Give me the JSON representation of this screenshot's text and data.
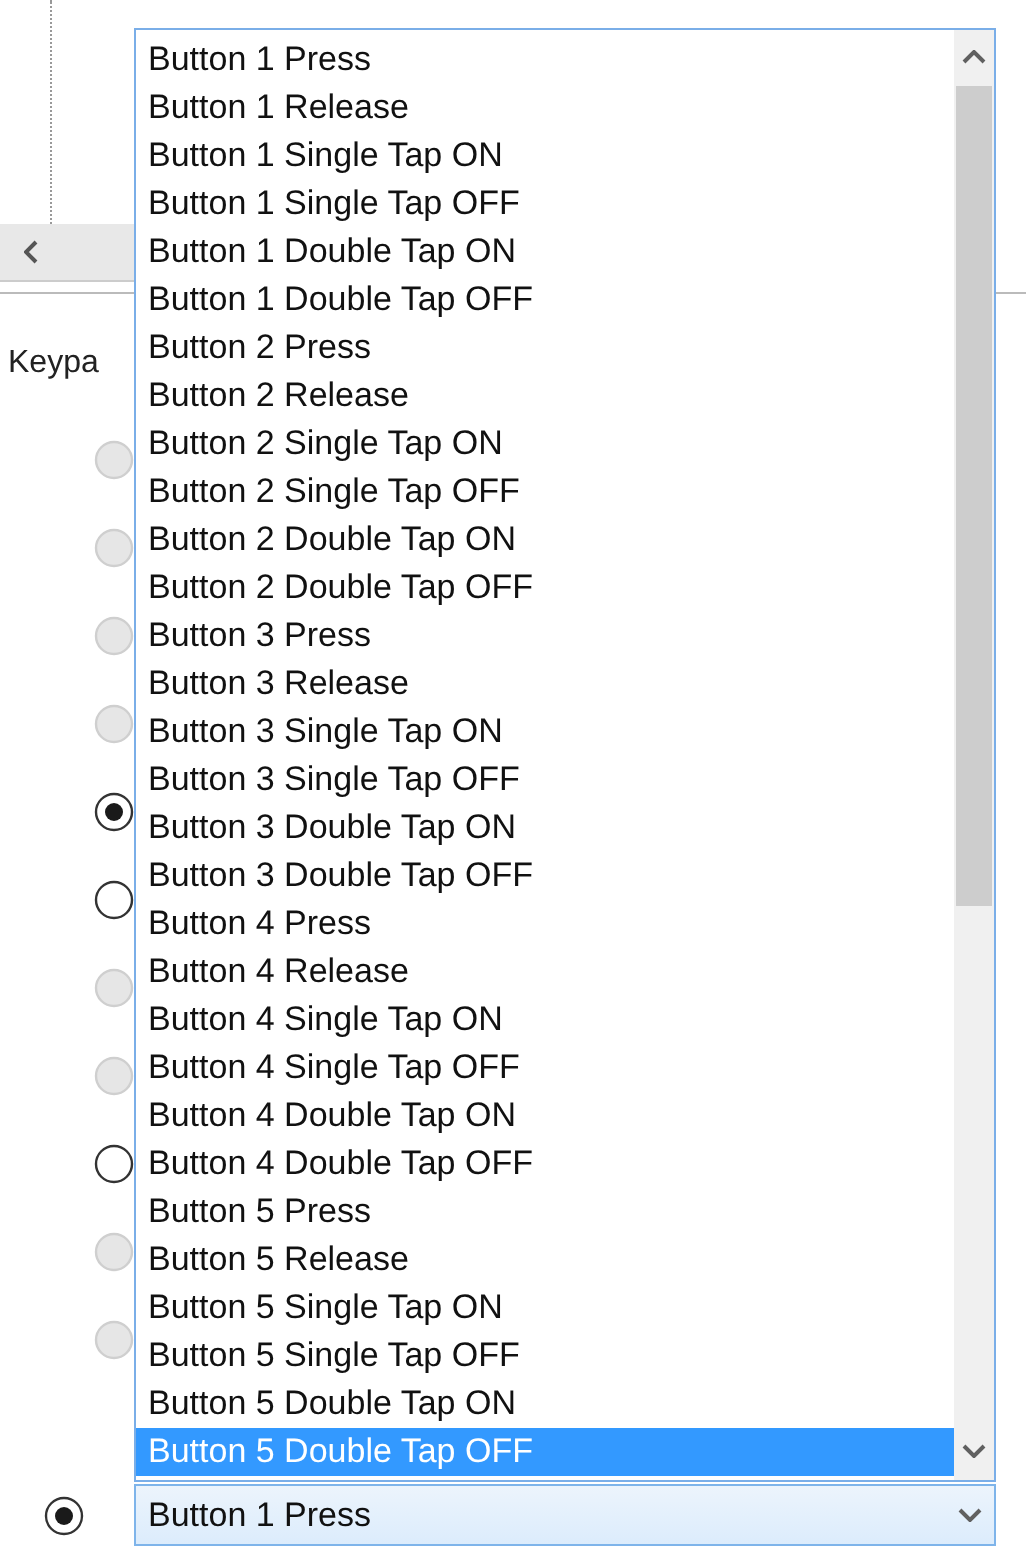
{
  "form": {
    "label": "Keypa"
  },
  "radios": [
    {
      "selected": false,
      "disabled": true
    },
    {
      "selected": false,
      "disabled": true
    },
    {
      "selected": false,
      "disabled": true
    },
    {
      "selected": false,
      "disabled": true
    },
    {
      "selected": true,
      "disabled": false
    },
    {
      "selected": false,
      "disabled": false
    },
    {
      "selected": false,
      "disabled": true
    },
    {
      "selected": false,
      "disabled": true
    },
    {
      "selected": false,
      "disabled": false
    },
    {
      "selected": false,
      "disabled": true
    },
    {
      "selected": false,
      "disabled": true
    }
  ],
  "dropdown": {
    "items": [
      {
        "label": "Button 1 Press",
        "selected": false
      },
      {
        "label": "Button 1 Release",
        "selected": false
      },
      {
        "label": "Button 1 Single Tap ON",
        "selected": false
      },
      {
        "label": "Button 1 Single Tap OFF",
        "selected": false
      },
      {
        "label": "Button 1 Double Tap ON",
        "selected": false
      },
      {
        "label": "Button 1 Double Tap OFF",
        "selected": false
      },
      {
        "label": "Button 2 Press",
        "selected": false
      },
      {
        "label": "Button 2 Release",
        "selected": false
      },
      {
        "label": "Button 2 Single Tap ON",
        "selected": false
      },
      {
        "label": "Button 2 Single Tap OFF",
        "selected": false
      },
      {
        "label": "Button 2 Double Tap ON",
        "selected": false
      },
      {
        "label": "Button 2 Double Tap OFF",
        "selected": false
      },
      {
        "label": "Button 3 Press",
        "selected": false
      },
      {
        "label": "Button 3 Release",
        "selected": false
      },
      {
        "label": "Button 3 Single Tap ON",
        "selected": false
      },
      {
        "label": "Button 3 Single Tap OFF",
        "selected": false
      },
      {
        "label": "Button 3 Double Tap ON",
        "selected": false
      },
      {
        "label": "Button 3 Double Tap OFF",
        "selected": false
      },
      {
        "label": "Button 4 Press",
        "selected": false
      },
      {
        "label": "Button 4 Release",
        "selected": false
      },
      {
        "label": "Button 4 Single Tap ON",
        "selected": false
      },
      {
        "label": "Button 4 Single Tap OFF",
        "selected": false
      },
      {
        "label": "Button 4 Double Tap ON",
        "selected": false
      },
      {
        "label": "Button 4 Double Tap OFF",
        "selected": false
      },
      {
        "label": "Button 5 Press",
        "selected": false
      },
      {
        "label": "Button 5 Release",
        "selected": false
      },
      {
        "label": "Button 5 Single Tap ON",
        "selected": false
      },
      {
        "label": "Button 5 Single Tap OFF",
        "selected": false
      },
      {
        "label": "Button 5 Double Tap ON",
        "selected": false
      },
      {
        "label": "Button 5 Double Tap OFF",
        "selected": true
      }
    ]
  },
  "combo": {
    "value": "Button 1 Press",
    "radio_selected": true
  }
}
